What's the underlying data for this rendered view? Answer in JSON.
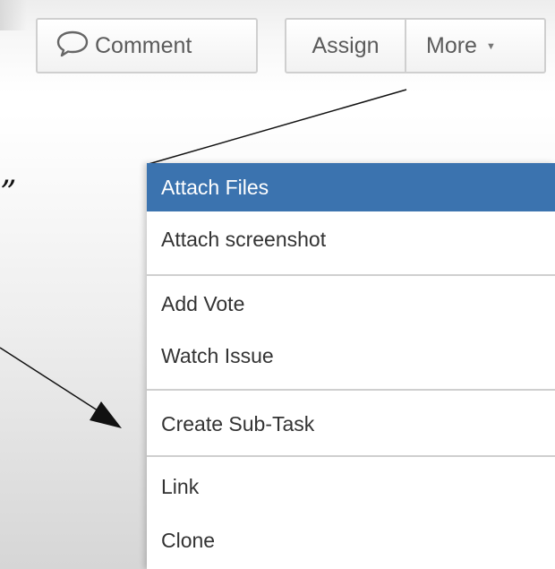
{
  "toolbar": {
    "comment_label": "Comment",
    "assign_label": "Assign",
    "more_label": "More"
  },
  "annotation": {
    "quote_mark": "”"
  },
  "menu": {
    "items": [
      {
        "label": "Attach Files",
        "active": true
      },
      {
        "label": "Attach screenshot",
        "active": false
      },
      {
        "label": "Add Vote",
        "active": false
      },
      {
        "label": "Watch Issue",
        "active": false
      },
      {
        "label": "Create Sub-Task",
        "active": false
      },
      {
        "label": "Link",
        "active": false
      },
      {
        "label": "Clone",
        "active": false
      }
    ]
  },
  "colors": {
    "highlight": "#3b73af",
    "menu_text": "#333333",
    "button_text": "#5b5b5b"
  },
  "icons": {
    "comment": "speech-bubble-icon",
    "more": "caret-down-icon"
  }
}
